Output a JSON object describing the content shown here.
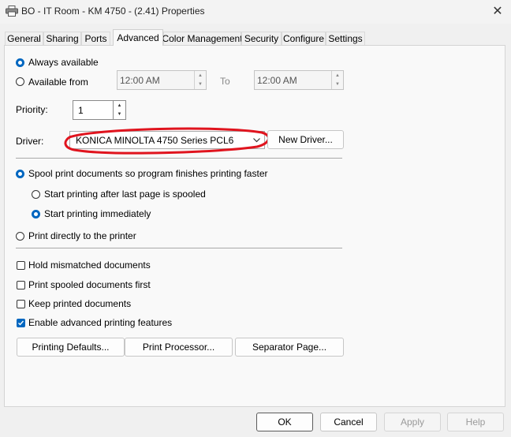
{
  "window": {
    "title": "BO - IT Room - KM 4750 - (2.41) Properties",
    "close_glyph": "✕"
  },
  "tabs": [
    {
      "label": "General"
    },
    {
      "label": "Sharing"
    },
    {
      "label": "Ports"
    },
    {
      "label": "Advanced"
    },
    {
      "label": "Color Management"
    },
    {
      "label": "Security"
    },
    {
      "label": "Configure"
    },
    {
      "label": "Settings"
    }
  ],
  "availability": {
    "always_label": "Always available",
    "from_label": "Available from",
    "from_time": "12:00 AM",
    "to_label": "To",
    "to_time": "12:00 AM",
    "selected": "always"
  },
  "priority": {
    "label": "Priority:",
    "value": "1"
  },
  "driver": {
    "label": "Driver:",
    "selected": "KONICA MINOLTA 4750 Series PCL6",
    "new_driver_label": "New Driver...",
    "annotation_color": "#e0141e"
  },
  "spooling": {
    "spool_label": "Spool print documents so program finishes printing faster",
    "after_last_page_label": "Start printing after last page is spooled",
    "immediately_label": "Start printing immediately",
    "direct_label": "Print directly to the printer"
  },
  "options": {
    "hold_mismatched_label": "Hold mismatched documents",
    "print_spooled_first_label": "Print spooled documents first",
    "keep_printed_label": "Keep printed documents",
    "enable_advanced_label": "Enable advanced printing features"
  },
  "buttons": {
    "printing_defaults": "Printing Defaults...",
    "print_processor": "Print Processor...",
    "separator_page": "Separator Page...",
    "ok": "OK",
    "cancel": "Cancel",
    "apply": "Apply",
    "help": "Help"
  },
  "colors": {
    "accent": "#0067c0"
  }
}
